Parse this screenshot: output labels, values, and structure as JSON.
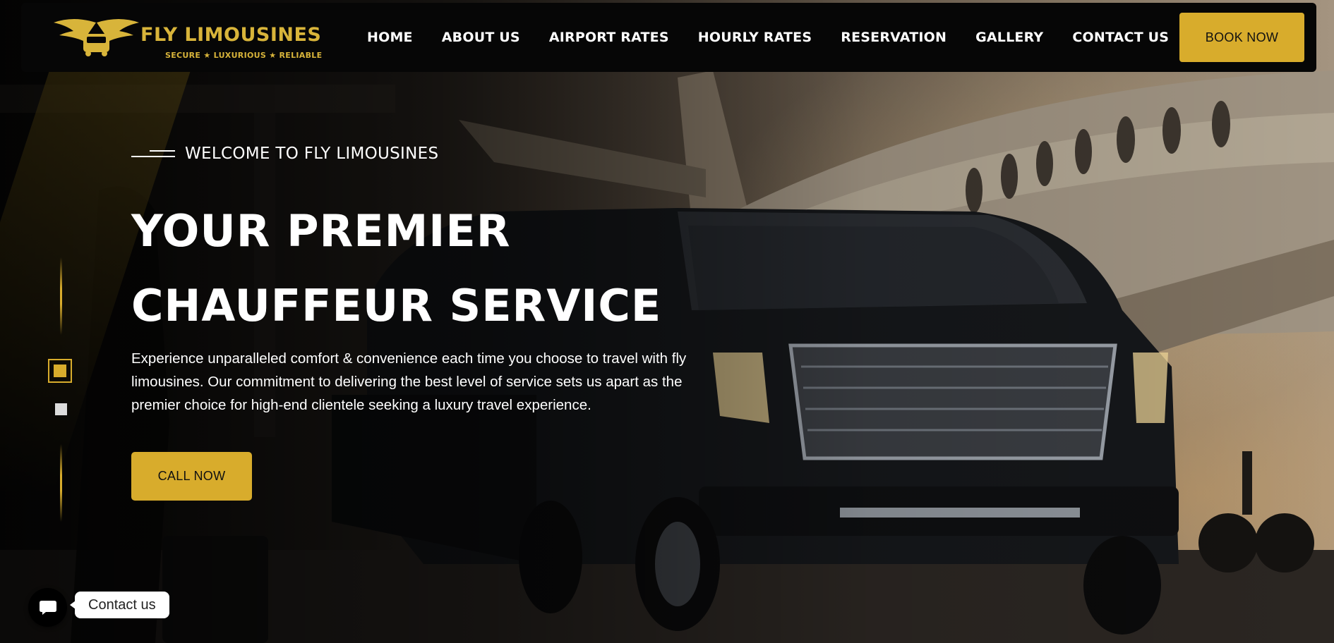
{
  "brand": {
    "name": "FLY LIMOUSINES",
    "tagline": "SECURE ★ LUXURIOUS ★ RELIABLE",
    "accent_color": "#d8ac2c",
    "logo_icon": "winged-car-emblem-icon"
  },
  "nav": {
    "items": [
      {
        "label": "HOME"
      },
      {
        "label": "ABOUT US"
      },
      {
        "label": "AIRPORT RATES"
      },
      {
        "label": "HOURLY RATES"
      },
      {
        "label": "RESERVATION"
      },
      {
        "label": "GALLERY"
      },
      {
        "label": "CONTACT US"
      }
    ],
    "cta_label": "BOOK NOW"
  },
  "hero": {
    "eyebrow": "WELCOME TO FLY LIMOUSINES",
    "headline_line1": "YOUR PREMIER",
    "headline_line2": "CHAUFFEUR SERVICE",
    "description": "Experience unparalleled comfort & convenience each time you choose to travel with fly limousines. Our commitment to delivering the best level of service sets us apart as the premier choice for high-end clientele seeking a luxury travel experience.",
    "cta_label": "CALL NOW",
    "background": "black limousine SUV parked in front of private jet at sunset"
  },
  "slider": {
    "total_slides": 2,
    "active_slide": 1
  },
  "contact_widget": {
    "label": "Contact us",
    "icon": "chat-bubble-icon"
  }
}
